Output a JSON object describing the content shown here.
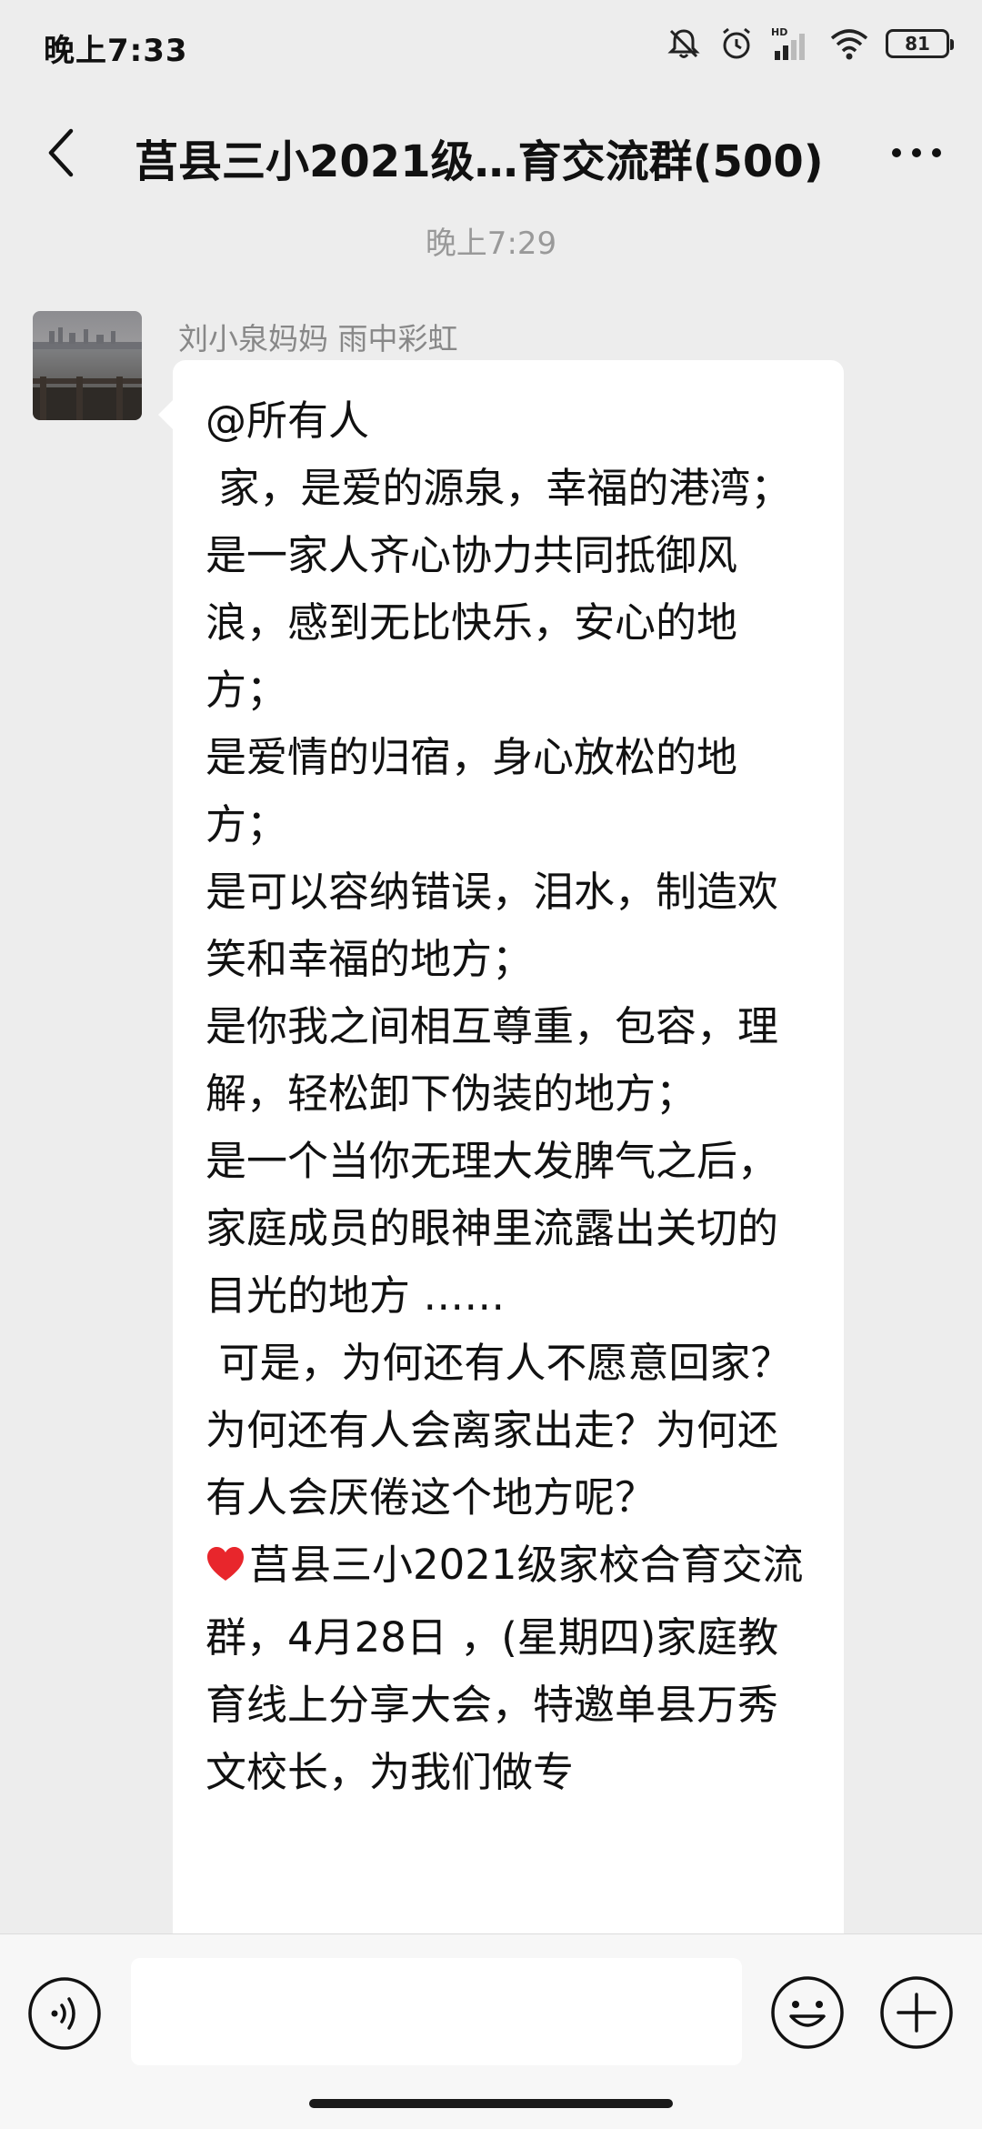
{
  "status_bar": {
    "time": "晚上7:33",
    "battery_level": "81",
    "icons": [
      "mute-bell-icon",
      "alarm-icon",
      "hd-signal-icon",
      "wifi-icon",
      "battery-icon"
    ]
  },
  "header": {
    "title": "莒县三小2021级…育交流群(500)",
    "back_icon": "chevron-left-icon",
    "more_icon": "more-dots-icon"
  },
  "chat": {
    "timestamp": "晚上7:29",
    "message": {
      "sender": "刘小泉妈妈  雨中彩虹",
      "text_before_heart": "@所有人\n 家，是爱的源泉，幸福的港湾；\n是一家人齐心协力共同抵御风浪，感到无比快乐，安心的地方；\n是爱情的归宿，身心放松的地方；\n是可以容纳错误，泪水，制造欢笑和幸福的地方；\n是你我之间相互尊重，包容，理解，轻松卸下伪装的地方；\n是一个当你无理大发脾气之后，家庭成员的眼神里流露出关切的目光的地方 ……\n 可是，为何还有人不愿意回家？为何还有人会离家出走？为何还有人会厌倦这个地方呢？\n",
      "heart_icon": "red-heart-icon",
      "text_after_heart": "莒县三小2021级家校合育交流群，4月28日 ，(星期四)家庭教育线上分享大会，特邀单县万秀文校长，为我们做专"
    }
  },
  "input_bar": {
    "placeholder": "",
    "voice_icon": "voice-icon",
    "emoji_icon": "emoji-icon",
    "plus_icon": "plus-icon"
  },
  "colors": {
    "background": "#ededed",
    "bubble": "#ffffff",
    "heart": "#e8262c"
  }
}
